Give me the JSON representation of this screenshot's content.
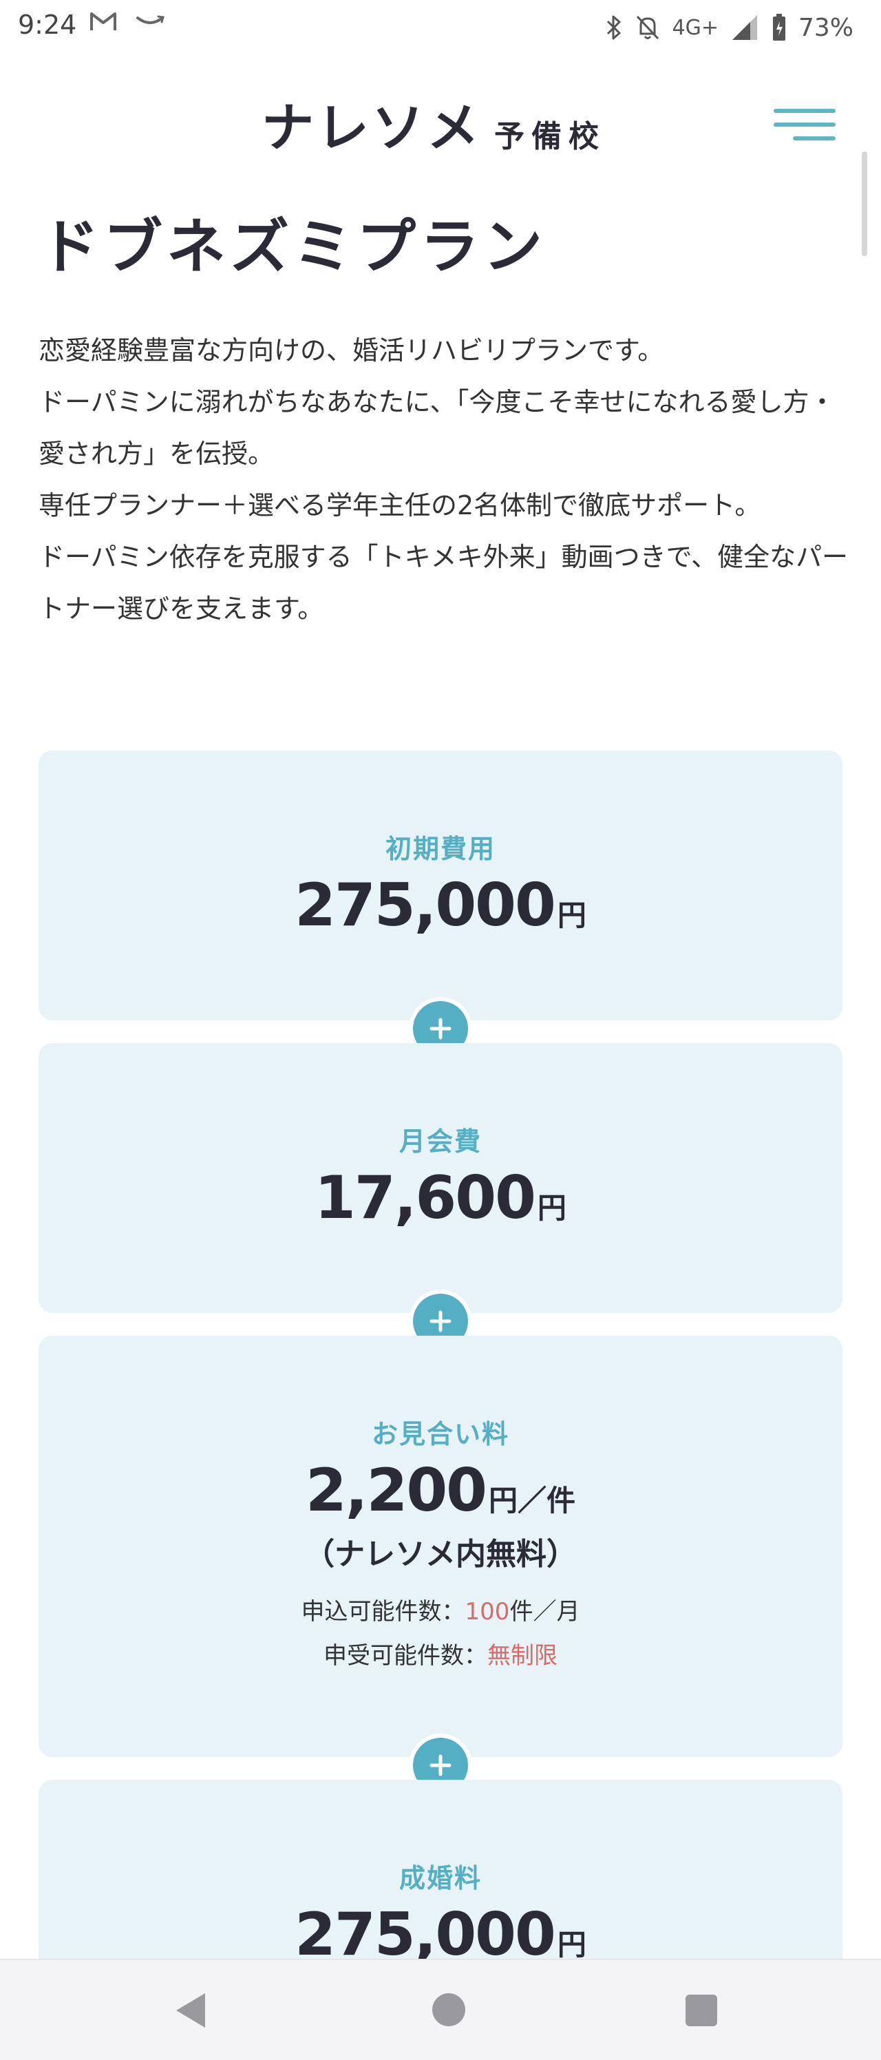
{
  "status_bar": {
    "time": "9:24",
    "network": "4G+",
    "battery": "73%",
    "icons": [
      "gmail-icon",
      "amazon-icon",
      "bluetooth-icon",
      "mute-icon",
      "signal-icon",
      "battery-icon"
    ]
  },
  "header": {
    "logo_main": "ナレソメ",
    "logo_sub": "予備校",
    "menu_icon": "hamburger-menu-icon"
  },
  "page": {
    "title": "ドブネズミプラン",
    "description": [
      "恋愛経験豊富な方向けの、婚活リハビリプランです。",
      "ドーパミンに溺れがちなあなたに、「今度こそ幸せになれる愛し方・愛され方」を伝授。",
      "専任プランナー＋選べる学年主任の2名体制で徹底サポート。",
      "ドーパミン依存を克服する「トキメキ外来」動画つきで、健全なパートナー選びを支えます。"
    ]
  },
  "pricing": {
    "initial": {
      "label": "初期費用",
      "value": "275,000",
      "unit": "円"
    },
    "monthly": {
      "label": "月会費",
      "value": "17,600",
      "unit": "円"
    },
    "omiai": {
      "label": "お見合い料",
      "value": "2,200",
      "unit": "円",
      "per": "／件",
      "note": "（ナレソメ内無料）",
      "apply_label": "申込可能件数：",
      "apply_value": "100",
      "apply_suffix": "件／月",
      "receive_label": "申受可能件数：",
      "receive_value": "無制限"
    },
    "marriage": {
      "label": "成婚料",
      "value": "275,000",
      "unit": "円"
    }
  },
  "colors": {
    "accent": "#55afc4",
    "card_bg": "#e8f3f7",
    "text_dark": "#2b2b38",
    "highlight_red": "#d96a6a"
  }
}
